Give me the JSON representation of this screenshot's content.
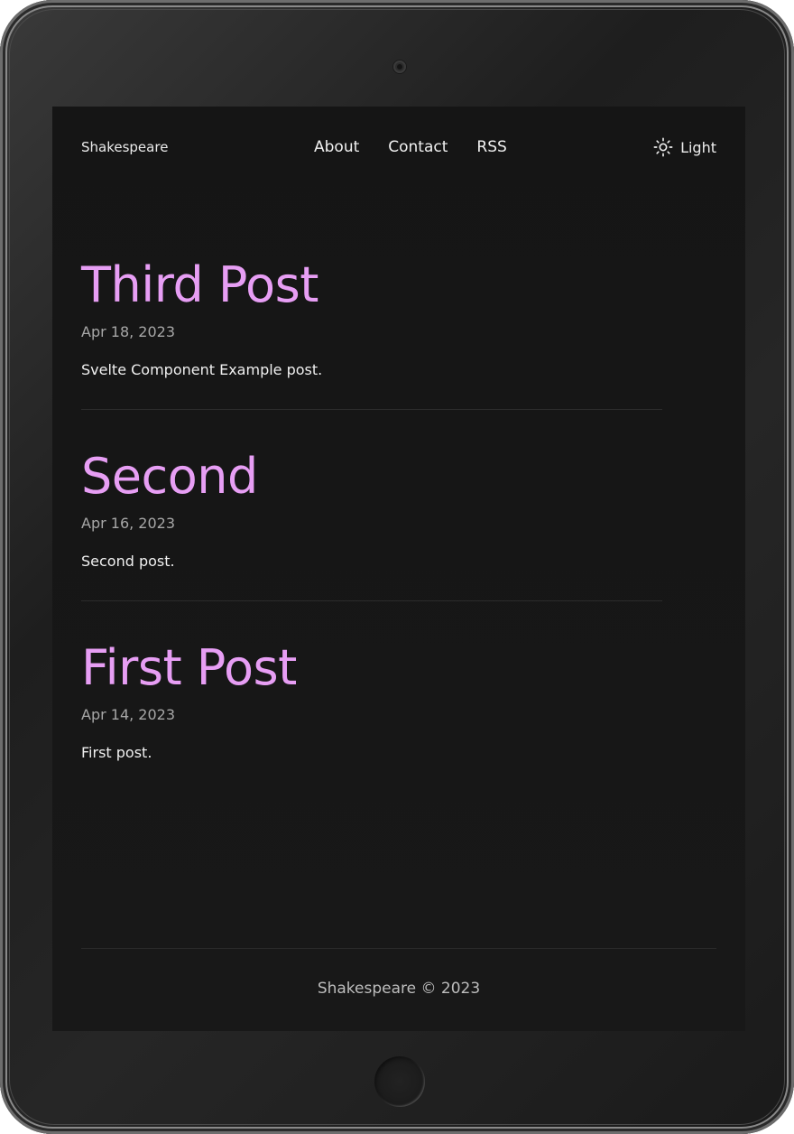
{
  "site": {
    "brand": "Shakespeare",
    "nav": [
      {
        "label": "About"
      },
      {
        "label": "Contact"
      },
      {
        "label": "RSS"
      }
    ],
    "theme_toggle": {
      "label": "Light",
      "icon": "sun-icon"
    }
  },
  "posts": [
    {
      "title": "Third Post",
      "date": "Apr 18, 2023",
      "description": "Svelte Component Example post."
    },
    {
      "title": "Second",
      "date": "Apr 16, 2023",
      "description": "Second post."
    },
    {
      "title": "First Post",
      "date": "Apr 14, 2023",
      "description": "First post."
    }
  ],
  "footer": {
    "text": "Shakespeare © 2023"
  },
  "colors": {
    "accent": "#e79ef4",
    "background": "#161616",
    "text": "#eeeeee",
    "muted": "#a7a7a7"
  }
}
